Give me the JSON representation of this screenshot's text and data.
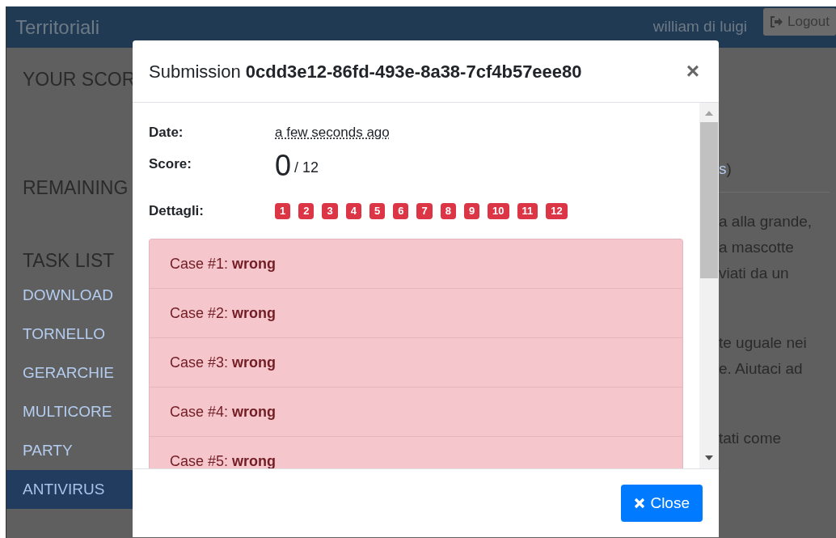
{
  "navbar": {
    "brand": "Territoriali",
    "user": "william di luigi",
    "logout": "Logout"
  },
  "sidebar": {
    "score_heading": "YOUR SCOR",
    "remaining_heading": "REMAINING",
    "task_heading": "TASK LIST",
    "tasks": [
      {
        "label": "DOWNLOAD",
        "selected": false
      },
      {
        "label": "TORNELLO",
        "selected": false
      },
      {
        "label": "GERARCHIE",
        "selected": false
      },
      {
        "label": "MULTICORE",
        "selected": false
      },
      {
        "label": "PARTY",
        "selected": false
      },
      {
        "label": "ANTIVIRUS",
        "selected": true
      }
    ]
  },
  "content": {
    "link_fragment": "s",
    "link_close": ")",
    "paragraphs": [
      [
        "a alla grande,",
        "a mascotte",
        "viati da un"
      ],
      [
        "te uguale nei",
        "e. Aiutaci ad"
      ],
      [
        "tati come"
      ]
    ]
  },
  "modal": {
    "title": "Submission",
    "submission_id": "0cdd3e12-86fd-493e-8a38-7cf4b57eee80",
    "close_x": "×",
    "date_label": "Date:",
    "date": "a few seconds ago",
    "score_label": "Score:",
    "score": "0",
    "score_max": "/ 12",
    "details_label": "Dettagli:",
    "badges": [
      "1",
      "2",
      "3",
      "4",
      "5",
      "6",
      "7",
      "8",
      "9",
      "10",
      "11",
      "12"
    ],
    "cases": [
      "Case #1: **wrong**",
      "Case #2: **wrong**",
      "Case #3: **wrong**",
      "Case #4: **wrong**",
      "Case #5: **wrong**"
    ],
    "close_button": "Close"
  }
}
